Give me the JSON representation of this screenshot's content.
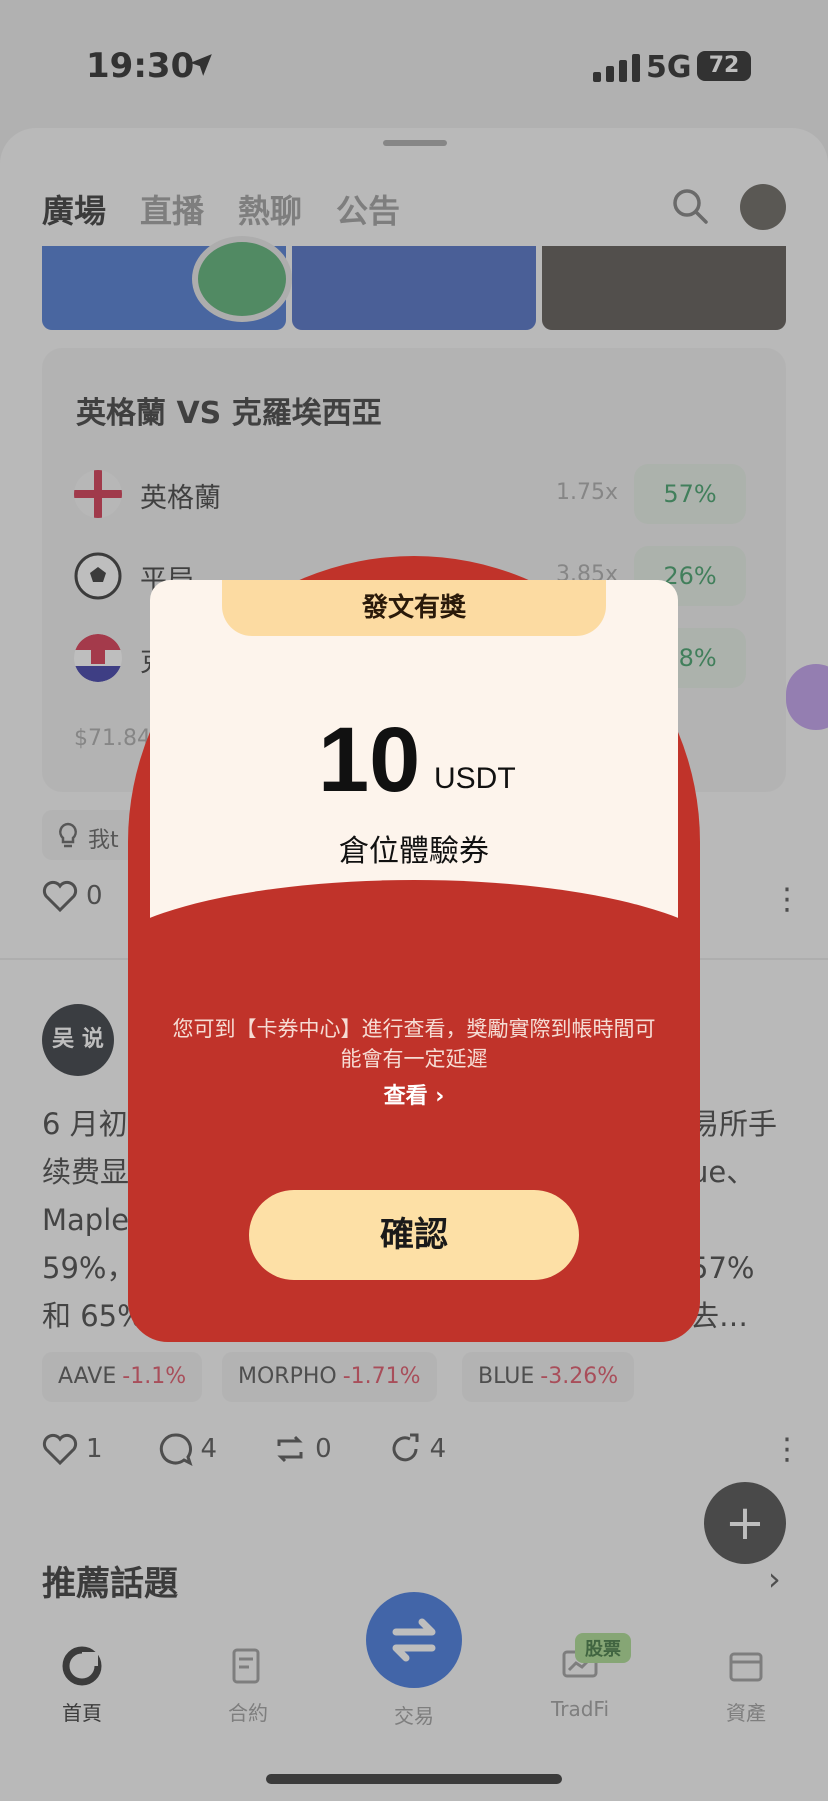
{
  "status": {
    "time": "19:30",
    "network": "5G",
    "battery": "72"
  },
  "tabs": [
    {
      "label": "廣場"
    },
    {
      "label": "直播"
    },
    {
      "label": "熱聊"
    },
    {
      "label": "公告"
    }
  ],
  "match": {
    "title": "英格蘭 VS 克羅埃西亞",
    "rows": [
      {
        "name": "英格蘭",
        "odds": "1.75x",
        "pct": "57%"
      },
      {
        "name": "平局",
        "odds": "3.85x",
        "pct": "26%"
      },
      {
        "name": "克",
        "odds": "",
        "pct": "18%"
      }
    ],
    "volume": "$71.84"
  },
  "tag_chip": "我t",
  "likes_1": "0",
  "post": {
    "author_avatar": "吴 说",
    "lines": [
      "6 月初",
      "续费显",
      "Maple",
      "59%，",
      "和 65%"
    ],
    "right_lines": [
      "易所手",
      "ue、",
      "",
      "57%",
      "去…"
    ]
  },
  "coins": [
    {
      "symbol": "AAVE",
      "change": "-1.1%"
    },
    {
      "symbol": "MORPHO",
      "change": "-1.71%"
    },
    {
      "symbol": "BLUE",
      "change": "-3.26%"
    }
  ],
  "post_actions": {
    "likes": "1",
    "comments": "4",
    "reposts": "0",
    "shares": "4"
  },
  "recommended": "推薦話題",
  "nav": [
    {
      "label": "首頁"
    },
    {
      "label": "合約"
    },
    {
      "label": "交易"
    },
    {
      "label": "TradFi"
    },
    {
      "label": "資產"
    }
  ],
  "stock_badge": "股票",
  "popup": {
    "header": "發文有獎",
    "amount": "10",
    "unit": "USDT",
    "coupon": "倉位體驗券",
    "notice": "您可到【卡券中心】進行查看，獎勵實際到帳時間可能會有一定延遲",
    "view_label": "查看 ›",
    "confirm_label": "確認"
  },
  "colors": {
    "packet_red": "#c0332a",
    "paper": "#fdf4ec",
    "gold": "#fde0a6",
    "green": "#1c8c4c",
    "red_change": "#d8334a",
    "trade_blue": "#1e5ed8"
  }
}
